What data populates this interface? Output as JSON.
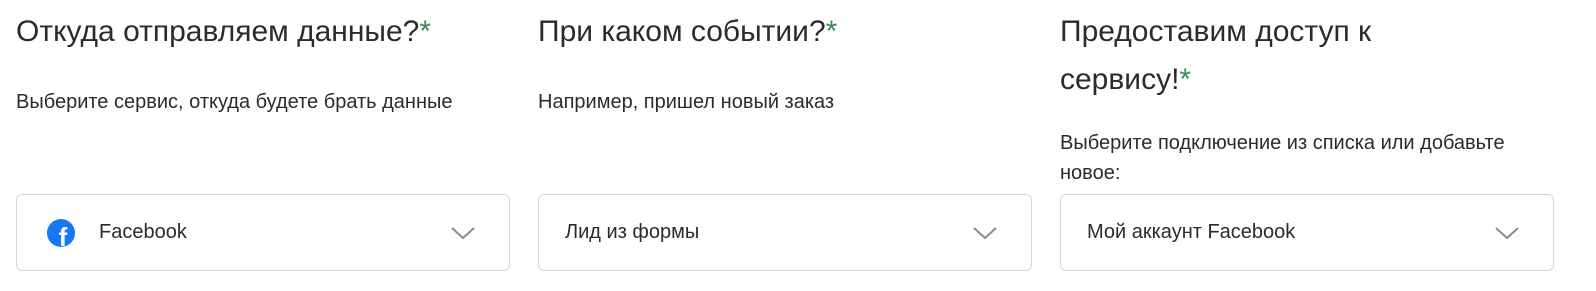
{
  "source": {
    "title": "Откуда отправляем данные?",
    "required_mark": "*",
    "hint": "Выберите сервис, откуда будете брать данные",
    "select_value": "Facebook",
    "select_icon": "facebook-icon"
  },
  "event": {
    "title": "При каком событии?",
    "required_mark": "*",
    "hint": "Например, пришел новый заказ",
    "select_value": "Лид из формы"
  },
  "access": {
    "title": "Предоставим доступ к сервису!",
    "required_mark": "*",
    "hint": "Выберите подключение из списка или добавьте новое:",
    "select_value": "Мой аккаунт Facebook"
  },
  "colors": {
    "required": "#3b8a5a",
    "facebook": "#1877f2",
    "border": "#d6d6d6",
    "chevron": "#8c8c8c"
  }
}
